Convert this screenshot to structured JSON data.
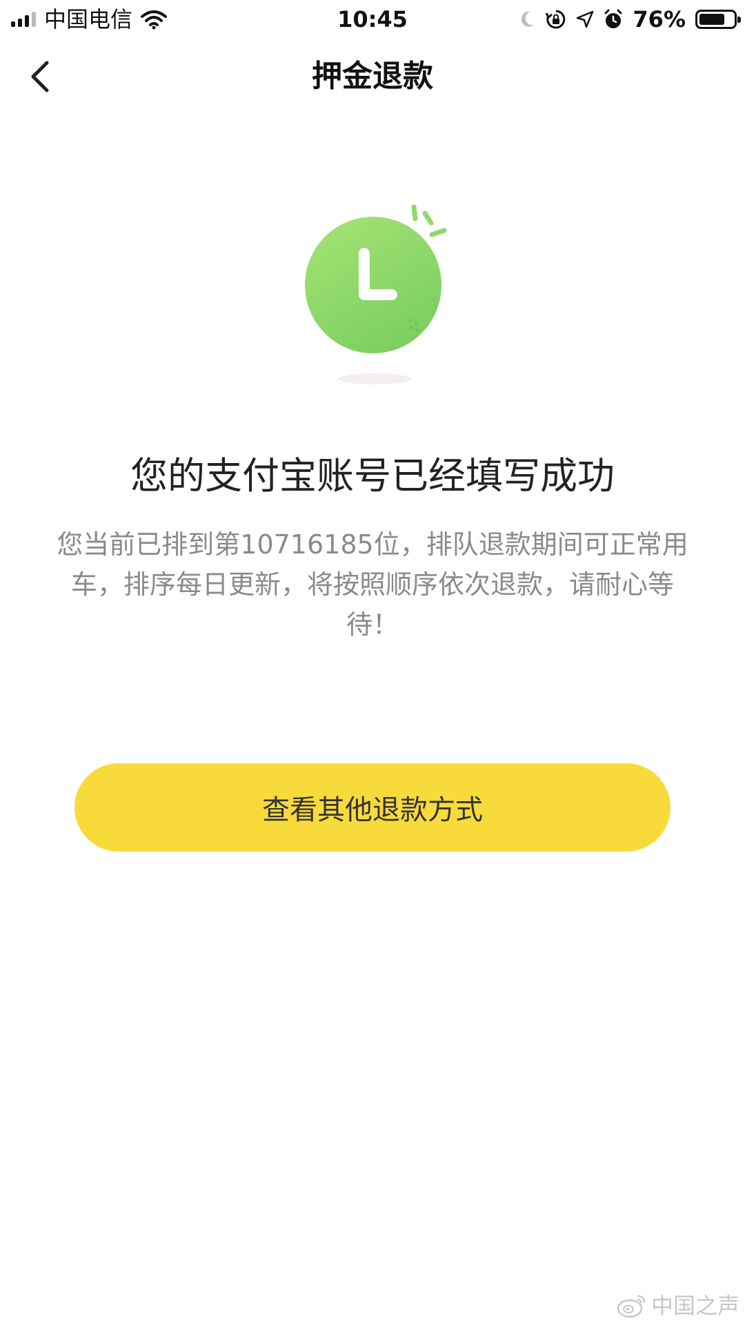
{
  "status_bar": {
    "carrier": "中国电信",
    "time": "10:45",
    "battery_percent": "76%",
    "battery_level": 0.76,
    "icons": [
      "signal-icon",
      "wifi-icon",
      "moon-icon",
      "rotation-lock-icon",
      "location-icon",
      "alarm-icon",
      "battery-icon"
    ]
  },
  "nav": {
    "title": "押金退款",
    "back_icon": "chevron-left-icon"
  },
  "illustration": {
    "icon": "clock-icon",
    "colors": {
      "clock_face": "#9fe06e",
      "clock_face_dark": "#7fd062",
      "shadow": "#f4eeee"
    }
  },
  "message": {
    "headline": "您的支付宝账号已经填写成功",
    "description": "您当前已排到第10716185位，排队退款期间可正常用车，排序每日更新，将按照顺序依次退款，请耐心等待！"
  },
  "actions": {
    "other_refund_label": "查看其他退款方式"
  },
  "watermark": {
    "text": "中国之声",
    "icon": "weibo-icon"
  },
  "colors": {
    "accent_yellow": "#f8da3b",
    "text_primary": "#222222",
    "text_secondary": "#8a8a8a"
  }
}
